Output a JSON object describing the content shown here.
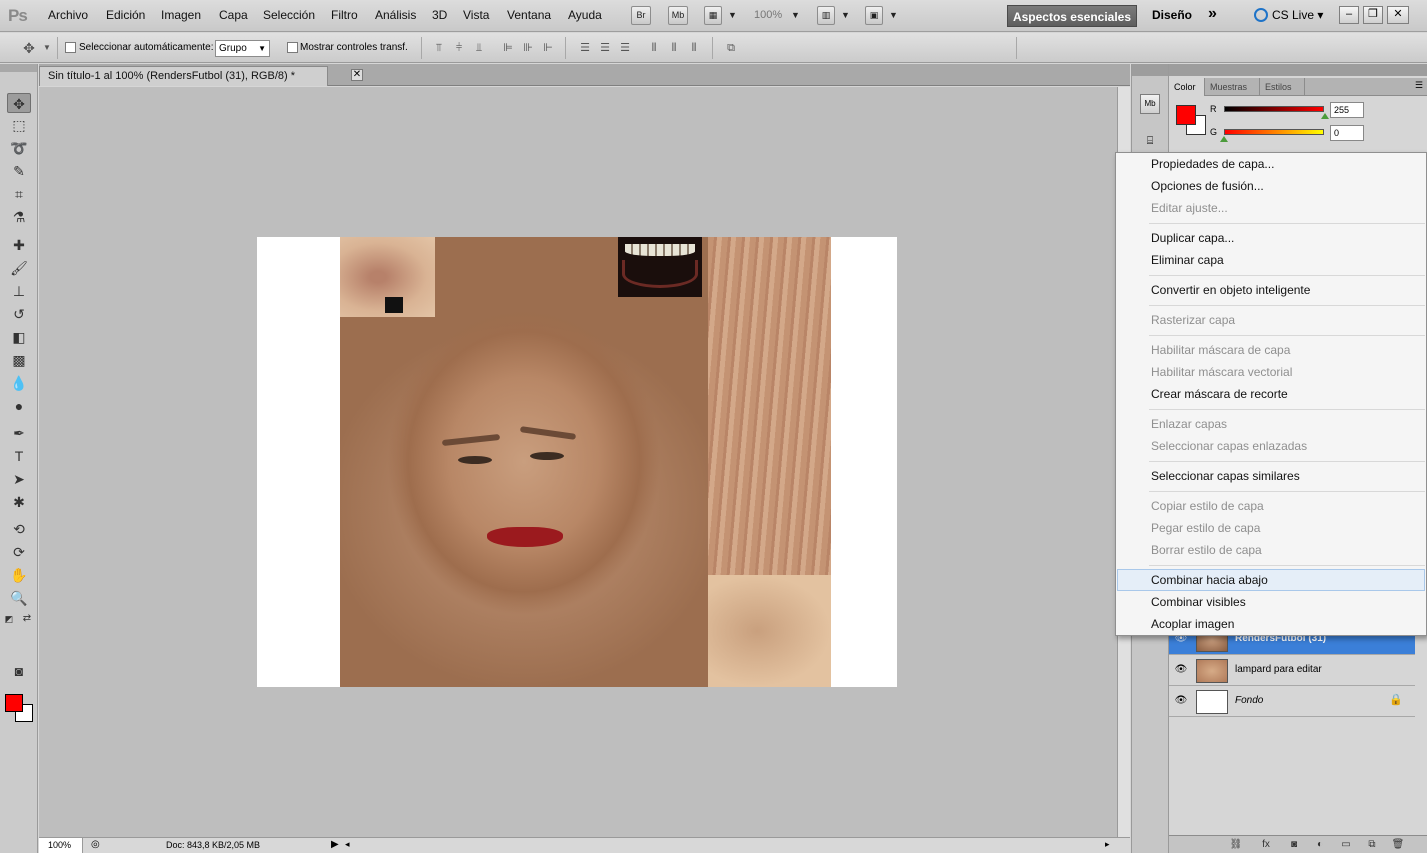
{
  "menubar": {
    "logo": "Ps",
    "items": [
      "Archivo",
      "Edición",
      "Imagen",
      "Capa",
      "Selección",
      "Filtro",
      "Análisis",
      "3D",
      "Vista",
      "Ventana",
      "Ayuda"
    ],
    "bridge": "Br",
    "minibridge": "Mb",
    "zoom": "100%",
    "workspace": "Aspectos esenciales",
    "design": "Diseño",
    "more": "»",
    "cslive": "CS Live"
  },
  "options": {
    "auto_select_label": "Seleccionar automáticamente:",
    "auto_select_value": "Grupo",
    "transform_label": "Mostrar controles transf."
  },
  "document": {
    "tab_title": "Sin título-1 al 100% (RendersFutbol (31), RGB/8) *",
    "zoom": "100%",
    "doc_size": "Doc: 843,8 KB/2,05 MB"
  },
  "dock": {
    "mb_button": "Mb"
  },
  "panels": {
    "tabs": [
      {
        "label": "Color",
        "active": true
      },
      {
        "label": "Muestras",
        "active": false
      },
      {
        "label": "Estilos",
        "active": false
      }
    ],
    "color": {
      "fg": "#ff0000",
      "bg": "#ffffff",
      "r_label": "R",
      "r_value": "255",
      "g_label": "G",
      "g_value": "0"
    },
    "layers": [
      {
        "name": "RendersFutbol (31)",
        "selected": true
      },
      {
        "name": "lampard para editar",
        "selected": false
      },
      {
        "name": "Fondo",
        "selected": false,
        "italic": true,
        "locked": true
      }
    ]
  },
  "context_menu": [
    {
      "label": "Propiedades de capa...",
      "enabled": true
    },
    {
      "label": "Opciones de fusión...",
      "enabled": true
    },
    {
      "label": "Editar ajuste...",
      "enabled": false
    },
    {
      "label": "Duplicar capa...",
      "enabled": true
    },
    {
      "label": "Eliminar capa",
      "enabled": true
    },
    {
      "label": "Convertir en objeto inteligente",
      "enabled": true
    },
    {
      "label": "Rasterizar capa",
      "enabled": false
    },
    {
      "label": "Habilitar máscara de capa",
      "enabled": false
    },
    {
      "label": "Habilitar máscara vectorial",
      "enabled": false
    },
    {
      "label": "Crear máscara de recorte",
      "enabled": true
    },
    {
      "label": "Enlazar capas",
      "enabled": false
    },
    {
      "label": "Seleccionar capas enlazadas",
      "enabled": false
    },
    {
      "label": "Seleccionar capas similares",
      "enabled": true
    },
    {
      "label": "Copiar estilo de capa",
      "enabled": false
    },
    {
      "label": "Pegar estilo de capa",
      "enabled": false
    },
    {
      "label": "Borrar estilo de capa",
      "enabled": false
    },
    {
      "label": "Combinar hacia abajo",
      "enabled": true,
      "hover": true
    },
    {
      "label": "Combinar visibles",
      "enabled": true
    },
    {
      "label": "Acoplar imagen",
      "enabled": true
    }
  ]
}
